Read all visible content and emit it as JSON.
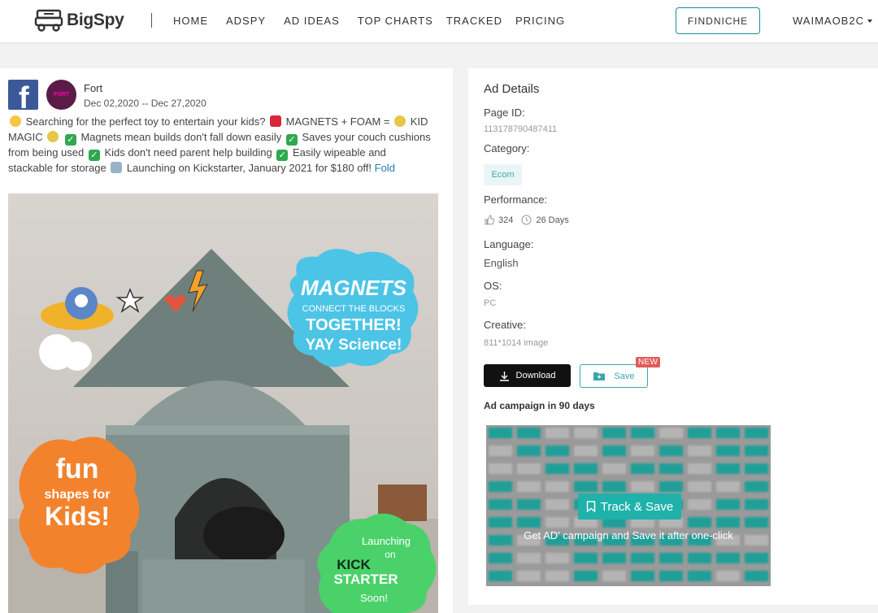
{
  "nav": {
    "brand": "BigSpy",
    "links": [
      "HOME",
      "ADSPY",
      "AD IDEAS",
      "TOP CHARTS",
      "TRACKED",
      "PRICING"
    ],
    "findniche": "FINDNICHE",
    "user": "WAIMAOB2C"
  },
  "ad": {
    "page_name": "Fort",
    "avatar_text": "FORT",
    "date_range": "Dec 02,2020 -- Dec 27,2020",
    "text_parts": [
      " Searching for the perfect toy to entertain your kids? ",
      " MAGNETS + FOAM = ",
      " KID MAGIC ",
      " Magnets mean builds don't fall down easily ",
      " Saves your couch cushions from being used ",
      " Kids don't need parent help building ",
      " Easily wipeable and stackable for storage ",
      " Launching on Kickstarter, January 2021 for $180 off! "
    ],
    "fold_label": "Fold",
    "creative": {
      "bubble_magnets": [
        "MAGNETS",
        "CONNECT THE BLOCKS",
        "TOGETHER!",
        "YAY Science!"
      ],
      "bubble_fun": [
        "fun",
        "shapes for",
        "Kids!"
      ],
      "bubble_kick": [
        "Launching",
        "on",
        "KICK",
        "STARTER",
        "Soon!"
      ]
    }
  },
  "details": {
    "title": "Ad Details",
    "page_id_label": "Page ID:",
    "page_id": "113178790487411",
    "category_label": "Category:",
    "category": "Ecom",
    "performance_label": "Performance:",
    "likes": "324",
    "duration": "26 Days",
    "language_label": "Language:",
    "language": "English",
    "os_label": "OS:",
    "os": "PC",
    "creative_label": "Creative:",
    "creative": "811*1014 image",
    "download": "Download",
    "save": "Save",
    "new_badge": "NEW",
    "campaign_title": "Ad campaign in 90 days",
    "track_button": "Track & Save",
    "track_note": "Get AD' campaign and Save it after one-click"
  },
  "colors": {
    "accent": "#1fb2aa",
    "facebook": "#3b5998",
    "badge": "#e35a5a"
  }
}
